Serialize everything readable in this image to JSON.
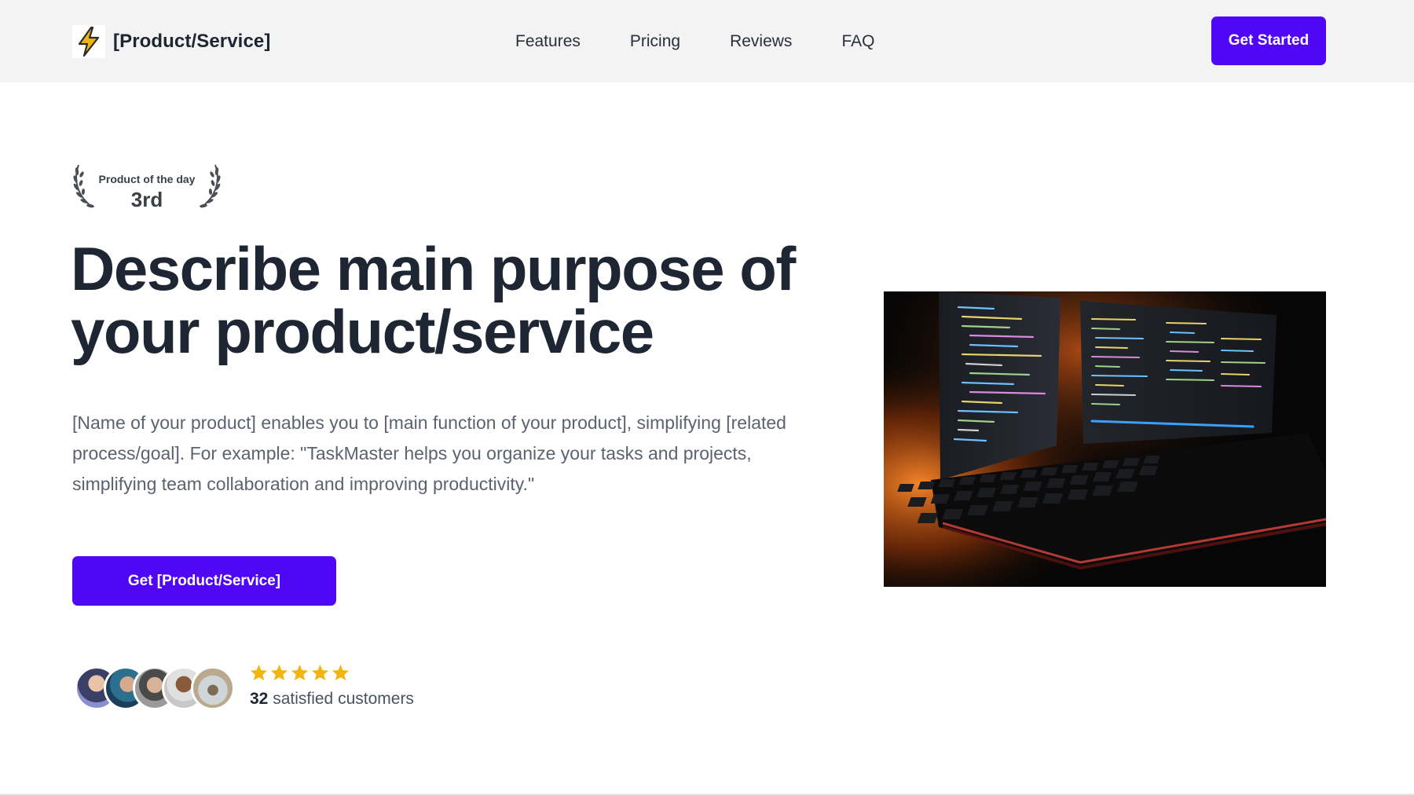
{
  "header": {
    "brand_name": "[Product/Service]",
    "brand_icon": "lightning-bolt-icon",
    "nav": [
      "Features",
      "Pricing",
      "Reviews",
      "FAQ"
    ],
    "cta_label": "Get Started"
  },
  "badge": {
    "label": "Product of the day",
    "rank": "3rd"
  },
  "hero": {
    "title": "Describe main purpose of your product/service",
    "description": "[Name of your product] enables you to [main function of your product], simplifying [related process/goal]. For example: \"TaskMaster helps you organize your tasks and projects, simplifying team collaboration and improving productivity.\"",
    "cta_label": "Get [Product/Service]",
    "image": "computer-monitors-and-keyboard-photo"
  },
  "social_proof": {
    "rating_stars": 5,
    "count": "32",
    "label": "satisfied customers"
  },
  "colors": {
    "accent": "#4f07f5",
    "star": "#f2b50f",
    "heading": "#1e2533",
    "body_text": "#5b6270",
    "header_bg": "#f3f3f3"
  }
}
